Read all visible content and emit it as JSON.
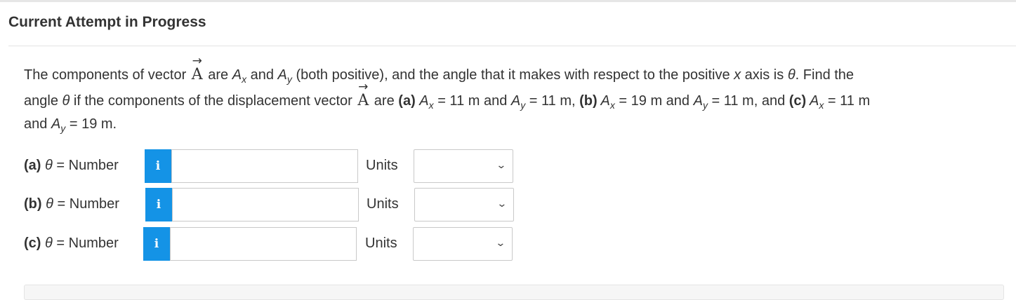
{
  "header": {
    "title": "Current Attempt in Progress"
  },
  "question": {
    "line1": {
      "p1": "The components of vector ",
      "vec": "A",
      "p2": " are ",
      "ax": "A",
      "ax_sub": "x",
      "p3": " and ",
      "ay": "A",
      "ay_sub": "y",
      "p4": " (both positive), and the angle that it makes with respect to the positive ",
      "x": "x",
      "p5": " axis is ",
      "theta": "θ",
      "p6": ". Find the"
    },
    "line2": {
      "p1": "angle ",
      "theta": "θ",
      "p2": " if the components of the displacement vector ",
      "vec": "A",
      "p3": " are ",
      "a_label": "(a)",
      "a_ax": "A",
      "a_ax_sub": "x",
      "a_ax_val": " = 11 m and ",
      "a_ay": "A",
      "a_ay_sub": "y",
      "a_ay_val": " = 11 m, ",
      "b_label": "(b)",
      "b_ax": " A",
      "b_ax_sub": "x",
      "b_ax_val": " = 19 m and ",
      "b_ay": "A",
      "b_ay_sub": "y",
      "b_ay_val": " = 11 m, and ",
      "c_label": "(c)",
      "c_ax": " A",
      "c_ax_sub": "x",
      "c_ax_val": " = 11 m"
    },
    "line3": {
      "p1": "and ",
      "c_ay": "A",
      "c_ay_sub": "y",
      "c_ay_val": " = 19 m."
    }
  },
  "answers": [
    {
      "part": "(a)",
      "theta": "θ",
      "eq": " = Number",
      "info": "i",
      "value": "",
      "units_label": "Units",
      "units_value": ""
    },
    {
      "part": "(b)",
      "theta": "θ",
      "eq": " = Number",
      "info": "i",
      "value": "",
      "units_label": "Units",
      "units_value": ""
    },
    {
      "part": "(c)",
      "theta": "θ",
      "eq": " = Number",
      "info": "i",
      "value": "",
      "units_label": "Units",
      "units_value": ""
    }
  ],
  "icons": {
    "info": "info-icon",
    "dropdown": "chevron-down-icon",
    "vector_arrow": "→",
    "chevron": "⌄"
  },
  "colors": {
    "info_button": "#1493e6",
    "text": "#333333"
  }
}
